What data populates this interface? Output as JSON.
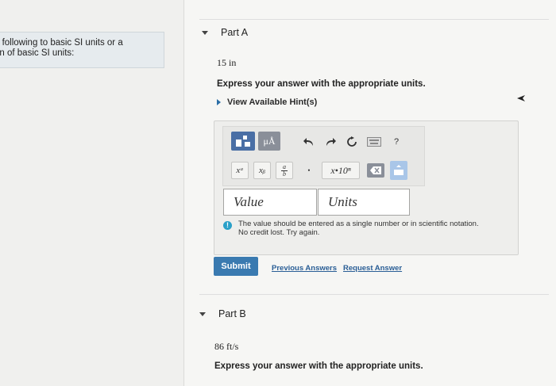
{
  "left": {
    "line1": "e following to basic SI units or a",
    "line2": "on of basic SI units:"
  },
  "partA": {
    "header": "Part A",
    "value_text": "15 in",
    "instruction": "Express your answer with the appropriate units.",
    "hint_label": "View Available Hint(s)",
    "toolbar": {
      "template_icon": "template-icon",
      "mu_a_label": "μÅ",
      "undo_icon": "undo-icon",
      "redo_icon": "redo-icon",
      "reset_icon": "reset-icon",
      "keyboard_icon": "keyboard-icon",
      "help_label": "?",
      "superscript_label": "xᵃ",
      "subscript_label": "xᵦ",
      "fraction_top": "a",
      "fraction_bottom": "b",
      "dot_label": "•",
      "sci_label": "x•10ⁿ",
      "backspace_icon": "backspace-icon",
      "keypad_icon": "keypad-icon"
    },
    "value_field": "Value",
    "units_field": "Units",
    "feedback_line1": "The value should be entered as a single number or in scientific notation.",
    "feedback_line2": "No credit lost. Try again.",
    "submit_label": "Submit",
    "previous_answers_label": "Previous Answers",
    "request_answer_label": "Request Answer"
  },
  "partB": {
    "header": "Part B",
    "value_text": "86 ft/s",
    "instruction": "Express your answer with the appropriate units."
  },
  "colors": {
    "submit": "#3a7ab0",
    "link": "#2a5e96",
    "warning": "#2aa0c8",
    "template_button": "#4a6fa5",
    "unit_button": "#8a8f99"
  }
}
